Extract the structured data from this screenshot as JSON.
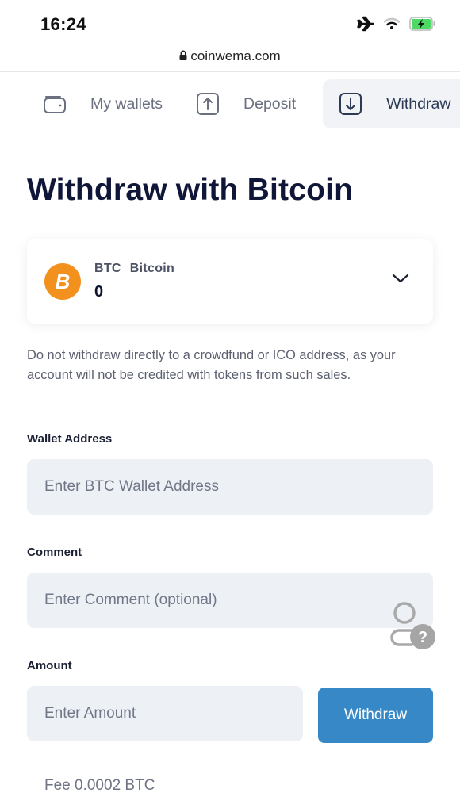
{
  "status_bar": {
    "time": "16:24",
    "icons": [
      "airplane-mode-icon",
      "wifi-icon",
      "battery-charging-icon"
    ],
    "battery_color": "#4cd964"
  },
  "browser": {
    "lock_icon": "lock-icon",
    "url": "coinwema.com"
  },
  "tabs": [
    {
      "label": "My wallets",
      "icon": "wallet-icon",
      "active": false
    },
    {
      "label": "Deposit",
      "icon": "arrow-up-box-icon",
      "active": false
    },
    {
      "label": "Withdraw",
      "icon": "arrow-down-box-icon",
      "active": true
    }
  ],
  "page": {
    "title": "Withdraw with Bitcoin"
  },
  "coin_selector": {
    "symbol": "BTC",
    "name": "Bitcoin",
    "balance": "0",
    "logo_glyph": "B",
    "logo_color": "#f3911e",
    "icon": "chevron-down-icon"
  },
  "notice": "Do not withdraw directly to a crowdfund or ICO address, as your account will not be credited with tokens from such sales.",
  "form": {
    "wallet_address": {
      "label": "Wallet Address",
      "placeholder": "Enter BTC Wallet Address",
      "value": ""
    },
    "comment": {
      "label": "Comment",
      "placeholder": "Enter Comment (optional)",
      "value": ""
    },
    "amount": {
      "label": "Amount",
      "placeholder": "Enter Amount",
      "value": ""
    },
    "submit_label": "Withdraw",
    "accent_color": "#3688c6",
    "fee_text": "Fee 0.0002 BTC"
  },
  "help_widget": {
    "icon": "user-help-icon",
    "glyph": "?"
  }
}
